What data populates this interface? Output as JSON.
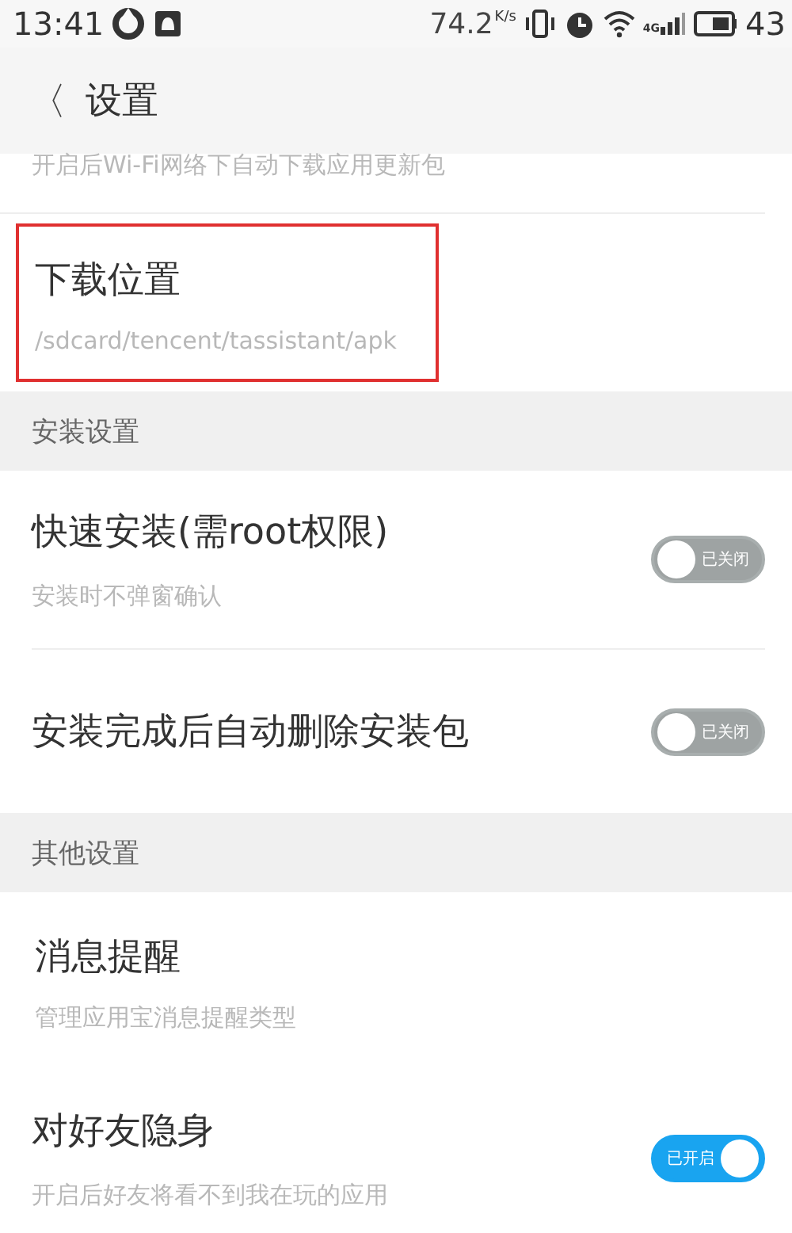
{
  "status_bar": {
    "time": "13:41",
    "speed": "74.2",
    "speed_unit": "K/s",
    "network": "4G",
    "battery": "43"
  },
  "header": {
    "back": "〈",
    "title": "设置"
  },
  "rows": [
    {
      "kind": "partial",
      "subtitle": "开启后Wi-Fi网络下自动下载应用更新包"
    },
    {
      "kind": "item",
      "title": "下载位置",
      "subtitle": "/sdcard/tencent/tassistant/apk",
      "highlighted": true
    },
    {
      "kind": "section",
      "title": "安装设置"
    },
    {
      "kind": "toggle",
      "title": "快速安装(需root权限)",
      "subtitle": "安装时不弹窗确认",
      "on": false,
      "state_label": "已关闭"
    },
    {
      "kind": "toggle",
      "title": "安装完成后自动删除安装包",
      "on": false,
      "state_label": "已关闭"
    },
    {
      "kind": "section",
      "title": "其他设置"
    },
    {
      "kind": "item",
      "title": "消息提醒",
      "subtitle": "管理应用宝消息提醒类型",
      "highlighted": false
    },
    {
      "kind": "toggle",
      "title": "对好友隐身",
      "subtitle": "开启后好友将看不到我在玩的应用",
      "on": true,
      "state_label": "已开启"
    }
  ]
}
